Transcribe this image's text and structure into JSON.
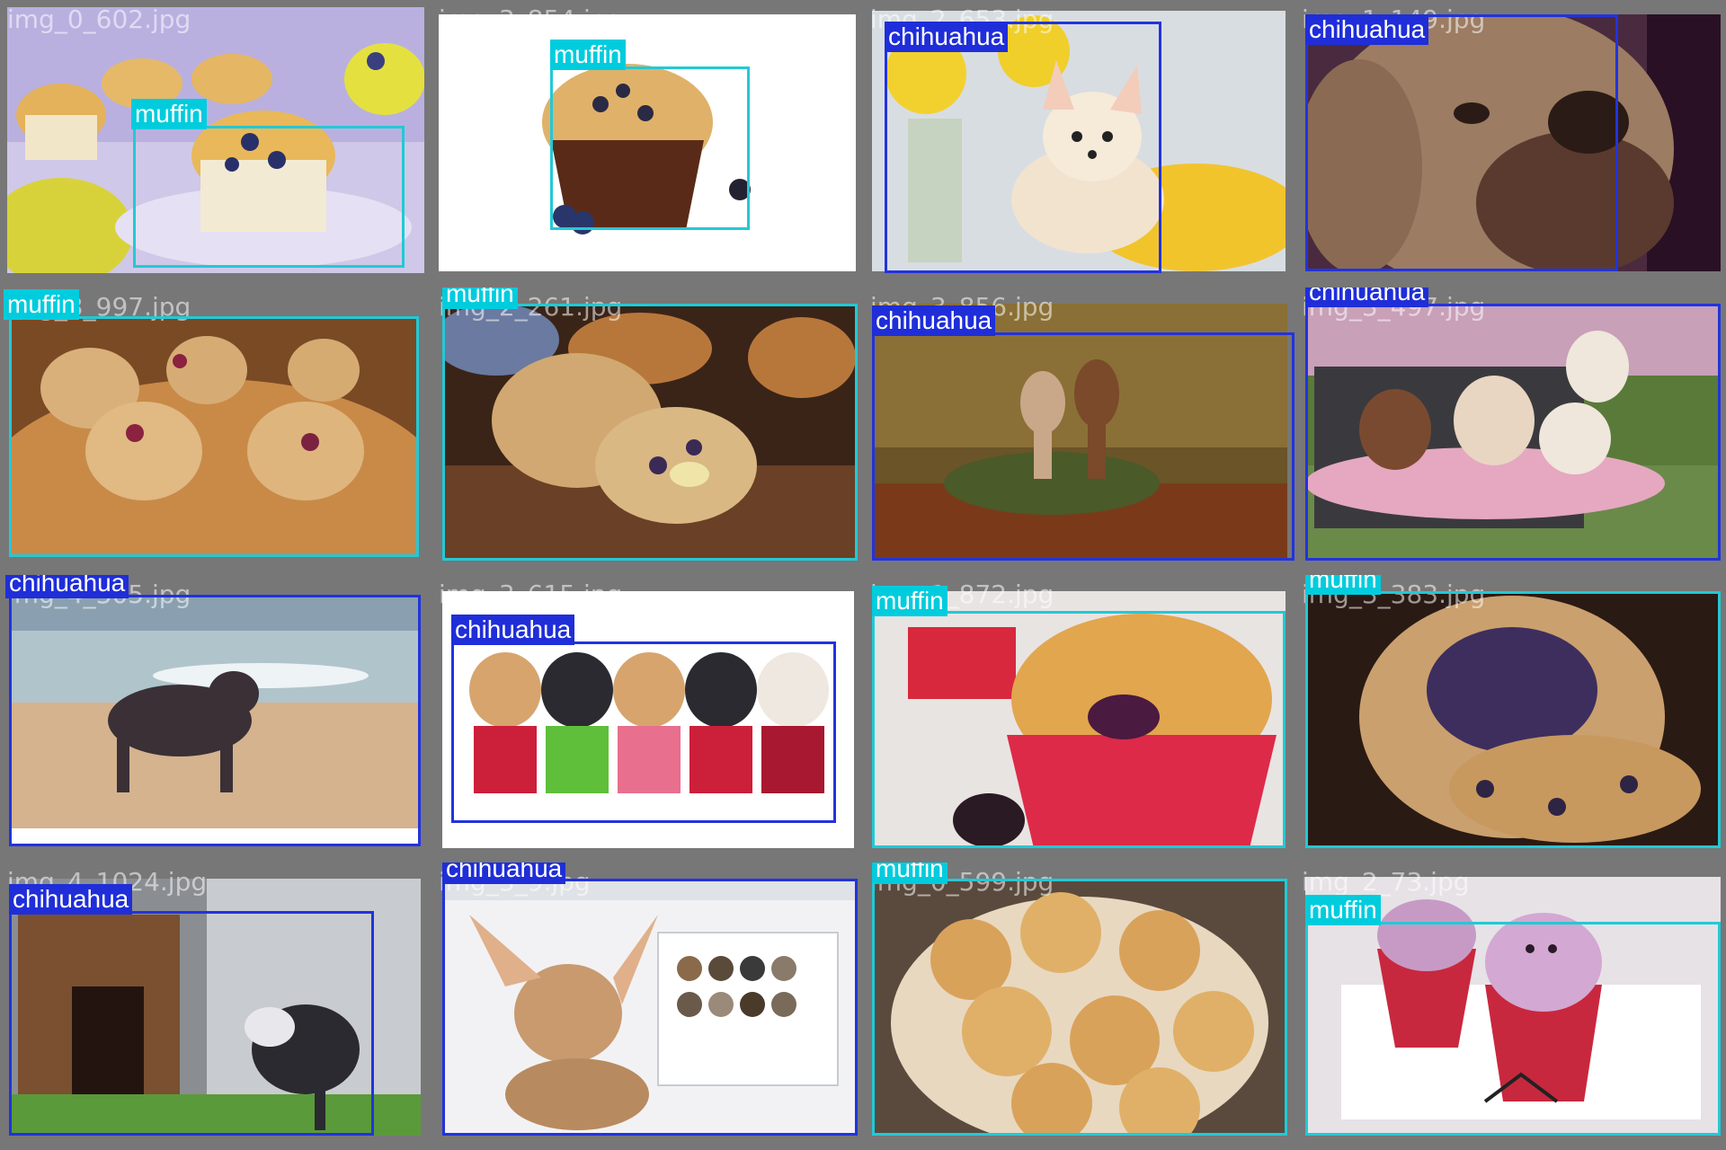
{
  "colors": {
    "muffin_box": "#22c9d6",
    "chihuahua_box": "#2233dd",
    "cell_border": "#777777"
  },
  "tiles": [
    {
      "filename": "img_0_602.jpg",
      "label": "muffin",
      "scene": "muffin-plate"
    },
    {
      "filename": "img_3_854.jpg",
      "label": "muffin",
      "scene": "muffin-white"
    },
    {
      "filename": "img_2_653.jpg",
      "label": "chihuahua",
      "scene": "dog-yellow"
    },
    {
      "filename": "img_1_149.jpg",
      "label": "chihuahua",
      "scene": "dog-purple"
    },
    {
      "filename": "img_3_997.jpg",
      "label": "muffin",
      "scene": "muffin-board"
    },
    {
      "filename": "img_2_261.jpg",
      "label": "muffin",
      "scene": "muffin-dark"
    },
    {
      "filename": "img_3_856.jpg",
      "label": "chihuahua",
      "scene": "dog-forest"
    },
    {
      "filename": "img_3_497.jpg",
      "label": "chihuahua",
      "scene": "dog-stroller"
    },
    {
      "filename": "img_4_305.jpg",
      "label": "chihuahua",
      "scene": "dog-beach"
    },
    {
      "filename": "img_3_615.jpg",
      "label": "chihuahua",
      "scene": "dog-row"
    },
    {
      "filename": "img_1_872.jpg",
      "label": "muffin",
      "scene": "muffin-red"
    },
    {
      "filename": "img_3_383.jpg",
      "label": "muffin",
      "scene": "muffin-closeup"
    },
    {
      "filename": "img_4_1024.jpg",
      "label": "chihuahua",
      "scene": "dog-yard"
    },
    {
      "filename": "img_3_9.jpg",
      "label": "chihuahua",
      "scene": "dog-browser"
    },
    {
      "filename": "img_0_599.jpg",
      "label": "muffin",
      "scene": "muffin-pile"
    },
    {
      "filename": "img_2_73.jpg",
      "label": "muffin",
      "scene": "cupcake-ghost"
    }
  ]
}
